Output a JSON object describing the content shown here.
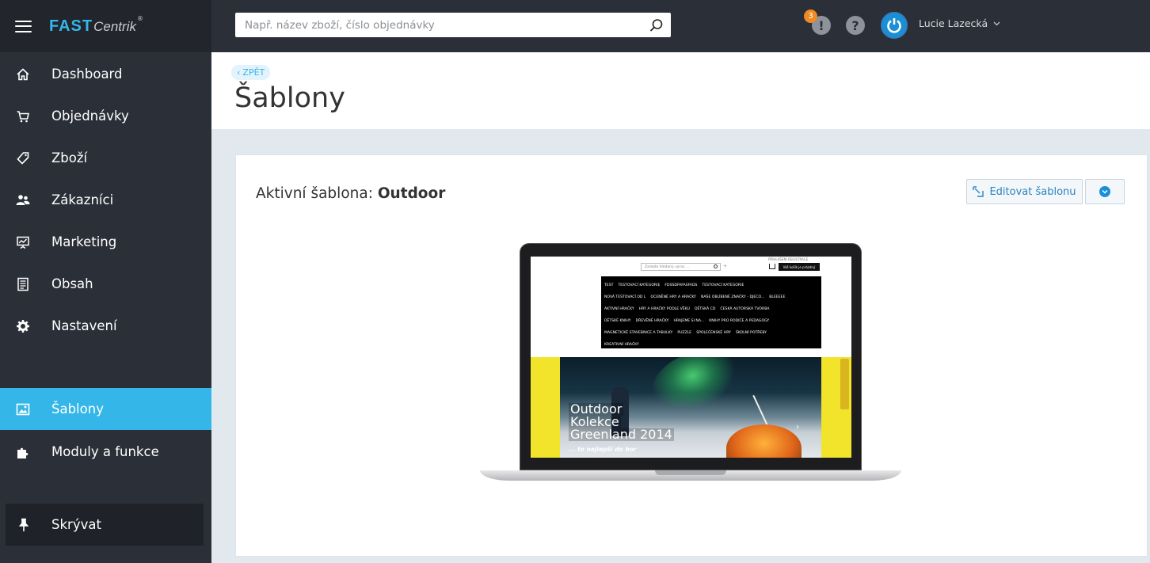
{
  "logo": {
    "fast": "FAST",
    "centrik": "Centrik",
    "reg": "®"
  },
  "sidebar": {
    "items": [
      {
        "label": "Dashboard",
        "icon": "home-icon"
      },
      {
        "label": "Objednávky",
        "icon": "cart-icon"
      },
      {
        "label": "Zboží",
        "icon": "tag-icon"
      },
      {
        "label": "Zákazníci",
        "icon": "users-icon"
      },
      {
        "label": "Marketing",
        "icon": "presentation-chart-icon"
      },
      {
        "label": "Obsah",
        "icon": "document-icon"
      },
      {
        "label": "Nastavení",
        "icon": "gear-icon"
      },
      {
        "label": "Šablony",
        "icon": "image-icon",
        "active": true
      },
      {
        "label": "Moduly a funkce",
        "icon": "puzzle-icon"
      }
    ],
    "pin": {
      "label": "Skrývat",
      "icon": "pin-icon"
    }
  },
  "topbar": {
    "search_placeholder": "Např. název zboží, číslo objednávky",
    "notification_count": "3",
    "notification_symbol": "!",
    "help_symbol": "?",
    "user_name": "Lucie Lazecká"
  },
  "header": {
    "back_label": "ZPĚT",
    "page_title": "Šablony"
  },
  "card": {
    "title_prefix": "Aktivní šablona:",
    "template_name": "Outdoor",
    "edit_button": "Editovat šablonu"
  },
  "preview": {
    "search_placeholder": "Zadejte hledaný výraz ...",
    "top_links": "PŘIHLÁŠENÍ    REGISTRACE",
    "cart_button": "Váš košík je prázdný",
    "menu_rows": [
      [
        "TEST",
        "TESTOVACÍ KATEGORIE",
        "FDSSDFAFASFADS",
        "TESTOVACÍ KATEGORIE"
      ],
      [
        "NOVÁ TESTOVACÍ OD L",
        "OCENĚNÉ HRY A HRAČKY",
        "NAŠE OBLÍBENÉ ZNAČKY - DJECO...",
        "BLEEEEE"
      ],
      [
        "AKTIVNÍ HRAČKY",
        "HRY A HRAČKY PODLE VĚKU",
        "DĚTSKÁ CD",
        "ČESKÁ AUTORSKÁ TVORBA"
      ],
      [
        "DĚTSKÉ KNIHY",
        "DŘEVĚNÉ HRAČKY",
        "HRAJEME SI NA...",
        "KNIHY PRO RODIČE A PEDAGOGY"
      ],
      [
        "MAGNETICKÉ STAVEBNICE A TABULKY",
        "PUZZLE",
        "SPOLEČENSKÉ HRY",
        "ŠKOLNÍ POTŘEBY"
      ],
      [
        "KREATIVNÍ HRAČKY"
      ]
    ],
    "banner_lines": [
      "Outdoor",
      "Kolekce",
      "Greenland 2014"
    ],
    "banner_sub": "... to nejlepší do hor"
  },
  "colors": {
    "accent": "#35b6e8",
    "sidebar": "#2b2f38",
    "badge": "#f08a24",
    "link": "#2785c2"
  }
}
